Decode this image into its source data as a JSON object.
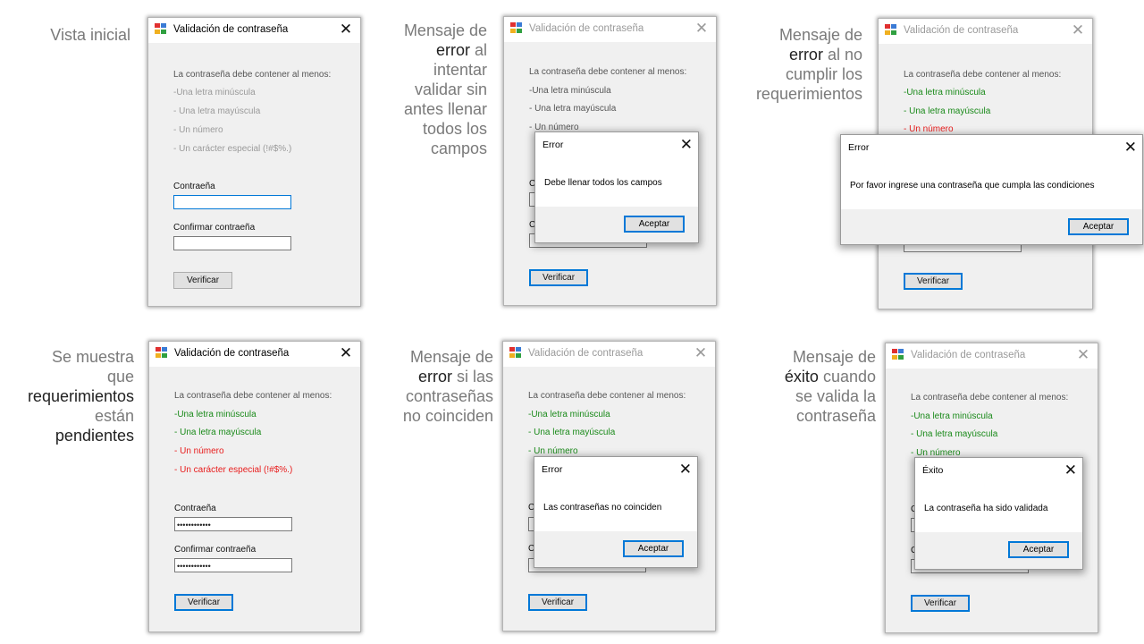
{
  "colors": {
    "accent": "#0078d7",
    "ok_green": "#1a8a1a",
    "error_red": "#e81c1c",
    "pending_gray": "#9a9a9a"
  },
  "captions": {
    "c1": {
      "l1": "Vista inicial"
    },
    "c2": {
      "l1": "Mensaje de",
      "l2_k": "error",
      "l2_r": " al",
      "l3": "intentar",
      "l4": "validar sin",
      "l5": "antes llenar",
      "l6": "todos los",
      "l7": "campos"
    },
    "c3": {
      "l1": "Mensaje de",
      "l2_k": "error",
      "l2_r": " al no",
      "l3": "cumplir los",
      "l4": "requerimientos"
    },
    "c4": {
      "l1": "Se muestra",
      "l2": "que",
      "l3_k": "requerimientos",
      "l4": "están",
      "l5_k": "pendientes"
    },
    "c5": {
      "l1": "Mensaje de",
      "l2_k": "error",
      "l2_r": " si las",
      "l3": "contraseñas",
      "l4": "no coinciden"
    },
    "c6": {
      "l1": "Mensaje de",
      "l2_k": "éxito",
      "l2_r": " cuando",
      "l3": "se valida la",
      "l4": "contraseña"
    }
  },
  "form": {
    "title": "Validación de contraseña",
    "intro": "La contraseña debe contener al menos:",
    "req1": "-Una letra minúscula",
    "req2": "- Una letra mayúscula",
    "req3": "- Un número",
    "req4": "- Un carácter especial (!#$%.)",
    "req4_alt": "- Un carácter especial (!#$%.)",
    "req3_clip": "- Un número",
    "pwd_label": "Contraeña",
    "confirm_label": "Confirmar contraeña",
    "pwd_mask": "••••••••••••",
    "verify": "Verificar",
    "close": "✕",
    "label_c_clip": "C"
  },
  "dialogs": {
    "d2": {
      "title": "Error",
      "message": "Debe llenar todos los campos",
      "ok": "Aceptar"
    },
    "d3": {
      "title": "Error",
      "message": "Por favor ingrese una contraseña que cumpla las condiciones",
      "ok": "Aceptar"
    },
    "d5": {
      "title": "Error",
      "message": "Las contraseñas no coinciden",
      "ok": "Aceptar"
    },
    "d6": {
      "title": "Éxito",
      "message": "La contraseña ha sido validada",
      "ok": "Aceptar"
    }
  }
}
